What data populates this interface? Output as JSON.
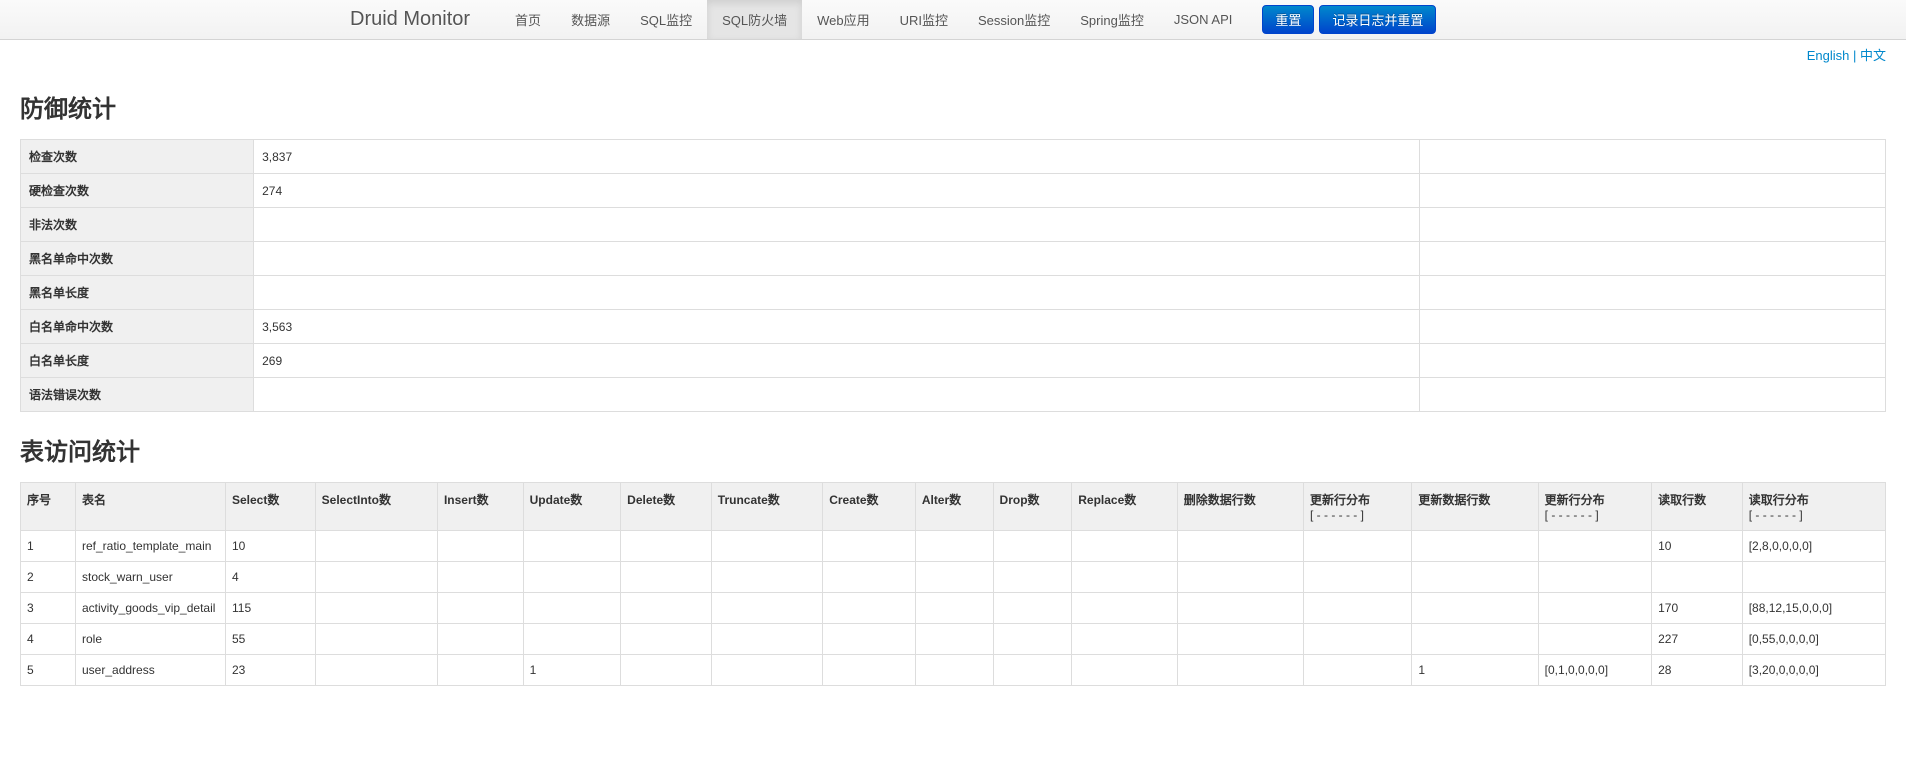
{
  "brand": "Druid Monitor",
  "nav": {
    "items": [
      {
        "label": "首页",
        "active": false
      },
      {
        "label": "数据源",
        "active": false
      },
      {
        "label": "SQL监控",
        "active": false
      },
      {
        "label": "SQL防火墙",
        "active": true
      },
      {
        "label": "Web应用",
        "active": false
      },
      {
        "label": "URI监控",
        "active": false
      },
      {
        "label": "Session监控",
        "active": false
      },
      {
        "label": "Spring监控",
        "active": false
      },
      {
        "label": "JSON API",
        "active": false
      }
    ],
    "buttons": {
      "reset": "重置",
      "log_reset": "记录日志并重置"
    }
  },
  "lang": {
    "english": "English",
    "chinese": "中文"
  },
  "defense_stats": {
    "title": "防御统计",
    "rows": [
      {
        "label": "检查次数",
        "value": "3,837"
      },
      {
        "label": "硬检查次数",
        "value": "274"
      },
      {
        "label": "非法次数",
        "value": ""
      },
      {
        "label": "黑名单命中次数",
        "value": ""
      },
      {
        "label": "黑名单长度",
        "value": ""
      },
      {
        "label": "白名单命中次数",
        "value": "3,563"
      },
      {
        "label": "白名单长度",
        "value": "269"
      },
      {
        "label": "语法错误次数",
        "value": ""
      }
    ]
  },
  "table_stats": {
    "title": "表访问统计",
    "headers": {
      "idx": "序号",
      "name": "表名",
      "select": "Select数",
      "selectinto": "SelectInto数",
      "insert": "Insert数",
      "update": "Update数",
      "delete": "Delete数",
      "truncate": "Truncate数",
      "create": "Create数",
      "alter": "Alter数",
      "drop": "Drop数",
      "replace": "Replace数",
      "delrows": "删除数据行数",
      "updatedist": "更新行分布",
      "updatedist_sub": "[ - - - - - - ]",
      "updrows": "更新数据行数",
      "updatedist2": "更新行分布",
      "updatedist2_sub": "[ - - - - - - ]",
      "readrows": "读取行数",
      "readdist": "读取行分布",
      "readdist_sub": "[ - - - - - - ]"
    },
    "rows": [
      {
        "idx": "1",
        "name": "ref_ratio_template_main",
        "select": "10",
        "selectinto": "",
        "insert": "",
        "update": "",
        "delete": "",
        "truncate": "",
        "create": "",
        "alter": "",
        "drop": "",
        "replace": "",
        "delrows": "",
        "updatedist": "",
        "updrows": "",
        "updatedist2": "",
        "readrows": "10",
        "readdist": "[2,8,0,0,0,0]"
      },
      {
        "idx": "2",
        "name": "stock_warn_user",
        "select": "4",
        "selectinto": "",
        "insert": "",
        "update": "",
        "delete": "",
        "truncate": "",
        "create": "",
        "alter": "",
        "drop": "",
        "replace": "",
        "delrows": "",
        "updatedist": "",
        "updrows": "",
        "updatedist2": "",
        "readrows": "",
        "readdist": ""
      },
      {
        "idx": "3",
        "name": "activity_goods_vip_detail",
        "select": "115",
        "selectinto": "",
        "insert": "",
        "update": "",
        "delete": "",
        "truncate": "",
        "create": "",
        "alter": "",
        "drop": "",
        "replace": "",
        "delrows": "",
        "updatedist": "",
        "updrows": "",
        "updatedist2": "",
        "readrows": "170",
        "readdist": "[88,12,15,0,0,0]"
      },
      {
        "idx": "4",
        "name": "role",
        "select": "55",
        "selectinto": "",
        "insert": "",
        "update": "",
        "delete": "",
        "truncate": "",
        "create": "",
        "alter": "",
        "drop": "",
        "replace": "",
        "delrows": "",
        "updatedist": "",
        "updrows": "",
        "updatedist2": "",
        "readrows": "227",
        "readdist": "[0,55,0,0,0,0]"
      },
      {
        "idx": "5",
        "name": "user_address",
        "select": "23",
        "selectinto": "",
        "insert": "",
        "update": "1",
        "delete": "",
        "truncate": "",
        "create": "",
        "alter": "",
        "drop": "",
        "replace": "",
        "delrows": "",
        "updatedist": "",
        "updrows": "1",
        "updatedist2": "[0,1,0,0,0,0]",
        "readrows": "28",
        "readdist": "[3,20,0,0,0,0]"
      }
    ]
  }
}
